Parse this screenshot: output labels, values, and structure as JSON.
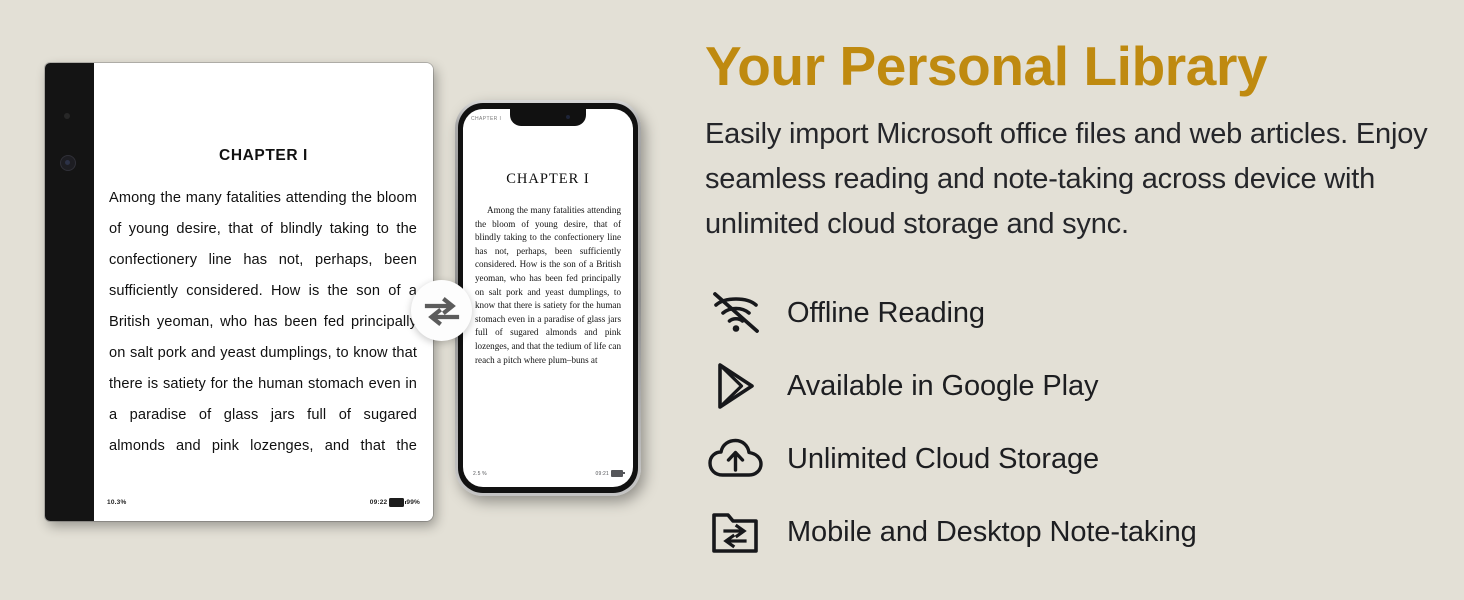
{
  "theme": {
    "background": "#e3e0d6",
    "accent": "#bf8a10",
    "text": "#1d1e21"
  },
  "headline": "Your Personal Library",
  "subcopy": "Easily import Microsoft office files and web articles. Enjoy seamless reading and note-taking across device with unlimited cloud storage and sync.",
  "features": [
    {
      "icon": "wifi-off-icon",
      "label": "Offline Reading"
    },
    {
      "icon": "google-play-icon",
      "label": "Available in Google Play"
    },
    {
      "icon": "cloud-upload-icon",
      "label": "Unlimited Cloud Storage"
    },
    {
      "icon": "folder-sync-icon",
      "label": "Mobile and Desktop Note-taking"
    }
  ],
  "ereader": {
    "chapter_title": "CHAPTER I",
    "body": "Among the many fatalities attending the bloom of young desire, that of blindly taking to the confectionery line has not, perhaps, been sufficiently considered. How is the son of a British yeoman, who has been fed principally on salt pork and yeast dumplings, to know that there is satiety for the human stomach even in a paradise of glass jars full of sugared almonds and pink lozenges, and that the",
    "status": {
      "progress": "10.3%",
      "time": "09:22",
      "battery": "99%"
    }
  },
  "phone": {
    "header_label": "CHAPTER I",
    "chapter_title": "CHAPTER I",
    "body": "Among the many fatalities attending the bloom of young desire, that of blindly taking to the confectionery line has not, perhaps, been sufficiently considered. How is the son of a British yeoman, who has been fed principally on salt pork and yeast dumplings, to know that there is satiety for the human stomach even in a paradise of glass jars full of sugared almonds and pink lozenges, and that the tedium of life can reach a pitch where plum–buns at",
    "status": {
      "progress": "2.5 %",
      "time": "09:21"
    }
  },
  "sync_badge": {
    "icon": "sync-arrows-icon"
  }
}
